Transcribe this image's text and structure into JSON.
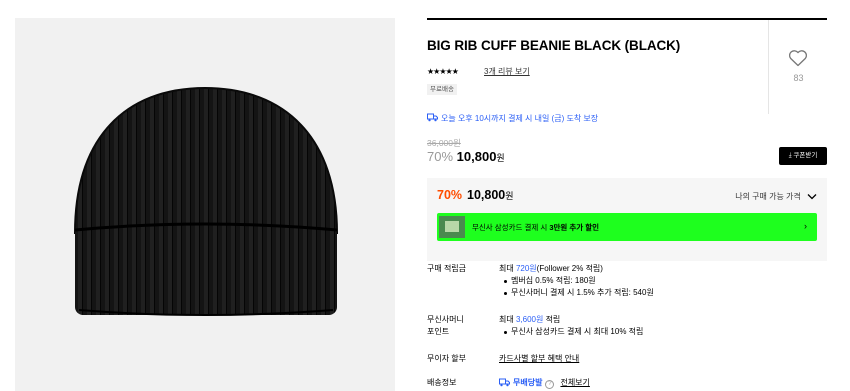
{
  "product": {
    "title": "BIG RIB CUFF BEANIE BLACK (BLACK)",
    "like_count": "83",
    "stars": "★★★★★",
    "review_link": "3개 리뷰 보기",
    "tag": "무료배송",
    "delivery": "오늘 오후 10시까지 결제 시 내일 (금) 도착 보장",
    "original_price": "36,000원",
    "discount_rate": "70%",
    "sale_price": "10,800",
    "won": "원",
    "coupon_button": "쿠폰받기"
  },
  "benefit": {
    "rate": "70%",
    "price": "10,800",
    "won": "원",
    "my_price_label": "나의 구매 가능 가격",
    "card_banner_prefix": "무신사 삼성카드 결제 시 ",
    "card_banner_bold": "3만원 추가 할인",
    "card_arrow": "›"
  },
  "points": {
    "label": "구매 적립금",
    "main_prefix": "최대 ",
    "main_amount": "720원",
    "main_suffix": "(Follower 2% 적립)",
    "sub1": "멤버십 0.5% 적립: 180원",
    "sub2": "무신사머니 결제 시 1.5% 추가 적립: 540원"
  },
  "money": {
    "label_line1": "무신사머니",
    "label_line2": "포인트",
    "main_prefix": "최대 ",
    "main_amount": "3,600원",
    "main_suffix": " 적립",
    "sub1": "무신사 삼성카드 결제 시 최대 10% 적립"
  },
  "installment": {
    "label": "무이자 할부",
    "link": "카드사별 할부 혜택 안내"
  },
  "shipping": {
    "label": "배송정보",
    "badge": "무배당발",
    "help": "?",
    "link": "전체보기"
  },
  "colors": {
    "accent_blue": "#2b5ff6",
    "discount_orange": "#ff4d00",
    "banner_green": "#1eff1e"
  },
  "icons": [
    "heart-icon",
    "truck-icon",
    "download-icon",
    "chevron-down-icon",
    "chevron-right-icon",
    "help-icon"
  ]
}
